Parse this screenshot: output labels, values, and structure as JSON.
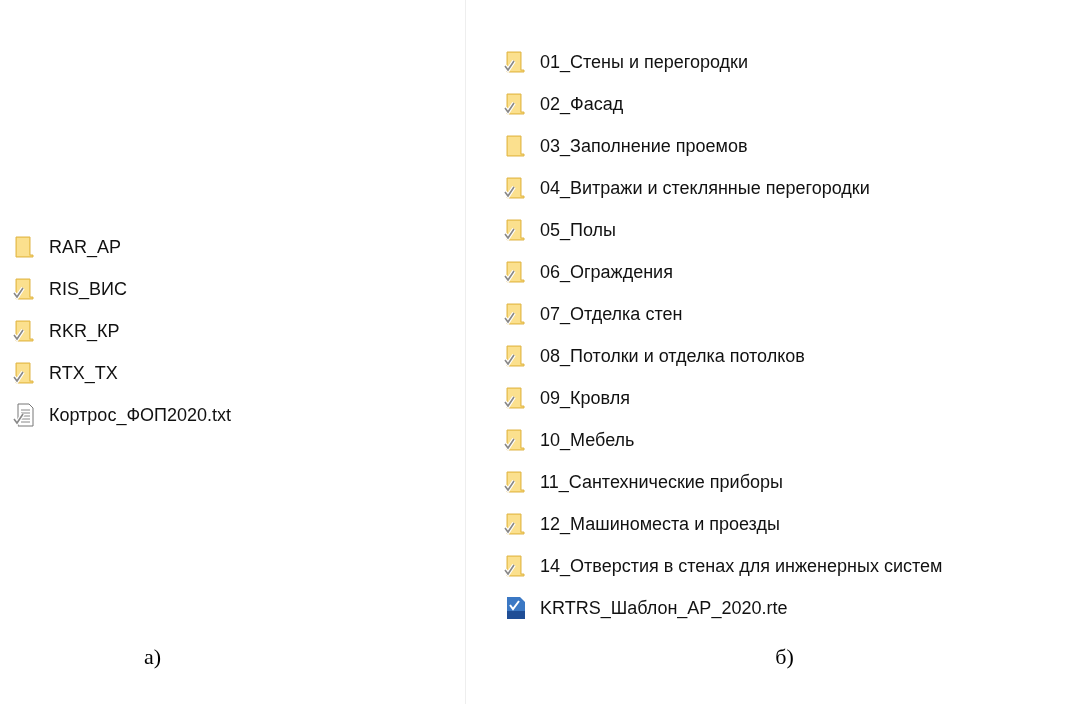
{
  "panels": [
    {
      "caption": "а)",
      "items": [
        {
          "name": "RAR_AP",
          "kind": "folder",
          "synced": false
        },
        {
          "name": "RIS_ВИС",
          "kind": "folder",
          "synced": true
        },
        {
          "name": "RKR_КР",
          "kind": "folder",
          "synced": true
        },
        {
          "name": "RTX_TX",
          "kind": "folder",
          "synced": true
        },
        {
          "name": "Кортрос_ФОП2020.txt",
          "kind": "text-file",
          "synced": true
        }
      ]
    },
    {
      "caption": "б)",
      "items": [
        {
          "name": "01_Стены и перегородки",
          "kind": "folder",
          "synced": true
        },
        {
          "name": "02_Фасад",
          "kind": "folder",
          "synced": true
        },
        {
          "name": "03_Заполнение проемов",
          "kind": "folder",
          "synced": false
        },
        {
          "name": "04_Витражи и стеклянные перегородки",
          "kind": "folder",
          "synced": true
        },
        {
          "name": "05_Полы",
          "kind": "folder",
          "synced": true
        },
        {
          "name": "06_Ограждения",
          "kind": "folder",
          "synced": true
        },
        {
          "name": "07_Отделка стен",
          "kind": "folder",
          "synced": true
        },
        {
          "name": "08_Потолки и отделка потолков",
          "kind": "folder",
          "synced": true
        },
        {
          "name": "09_Кровля",
          "kind": "folder",
          "synced": true
        },
        {
          "name": "10_Мебель",
          "kind": "folder",
          "synced": true
        },
        {
          "name": "11_Сантехнические приборы",
          "kind": "folder",
          "synced": true
        },
        {
          "name": "12_Машиноместа и проезды",
          "kind": "folder",
          "synced": true
        },
        {
          "name": "14_Отверстия в стенах для инженерных систем",
          "kind": "folder",
          "synced": true
        },
        {
          "name": "KRTRS_Шаблон_АР_2020.rte",
          "kind": "template-file",
          "synced": false
        }
      ]
    }
  ]
}
